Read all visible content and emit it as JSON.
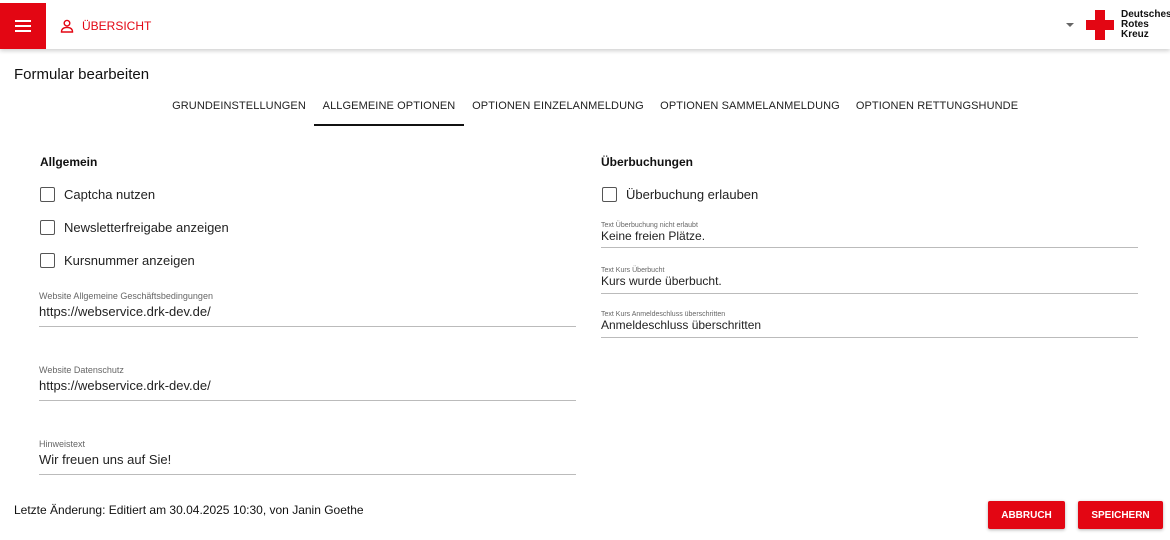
{
  "topbar": {
    "menu_icon": "menu-icon",
    "overview_label": "ÜBERSICHT",
    "overview_icon": "person-icon",
    "logo_lines": [
      "Deutsches",
      "Rotes",
      "Kreuz"
    ],
    "brand_color": "#e30613"
  },
  "page": {
    "title": "Formular bearbeiten"
  },
  "tabs": [
    {
      "label": "GRUNDEINSTELLUNGEN",
      "active": false
    },
    {
      "label": "ALLGEMEINE OPTIONEN",
      "active": true
    },
    {
      "label": "OPTIONEN EINZELANMELDUNG",
      "active": false
    },
    {
      "label": "OPTIONEN SAMMELANMELDUNG",
      "active": false
    },
    {
      "label": "OPTIONEN RETTUNGSHUNDE",
      "active": false
    }
  ],
  "left": {
    "title": "Allgemein",
    "checkboxes": [
      {
        "label": "Captcha nutzen",
        "checked": false
      },
      {
        "label": "Newsletterfreigabe anzeigen",
        "checked": false
      },
      {
        "label": "Kursnummer anzeigen",
        "checked": false
      }
    ],
    "fields": [
      {
        "label": "Website Allgemeine Geschäftsbedingungen",
        "value": "https://webservice.drk-dev.de/"
      },
      {
        "label": "Website Datenschutz",
        "value": "https://webservice.drk-dev.de/"
      },
      {
        "label": "Hinweistext",
        "value": "Wir freuen uns auf Sie!"
      }
    ]
  },
  "right": {
    "title": "Überbuchungen",
    "checkboxes": [
      {
        "label": "Überbuchung erlauben",
        "checked": false
      }
    ],
    "fields": [
      {
        "label": "Text Überbuchung nicht erlaubt",
        "value": "Keine freien Plätze."
      },
      {
        "label": "Text Kurs Überbucht",
        "value": "Kurs wurde überbucht."
      },
      {
        "label": "Text Kurs Anmeldeschluss überschritten",
        "value": "Anmeldeschluss überschritten"
      }
    ]
  },
  "footer": {
    "last_change": "Letzte Änderung: Editiert am 30.04.2025 10:30, von Janin Goethe",
    "cancel_label": "ABBRUCH",
    "save_label": "SPEICHERN"
  }
}
